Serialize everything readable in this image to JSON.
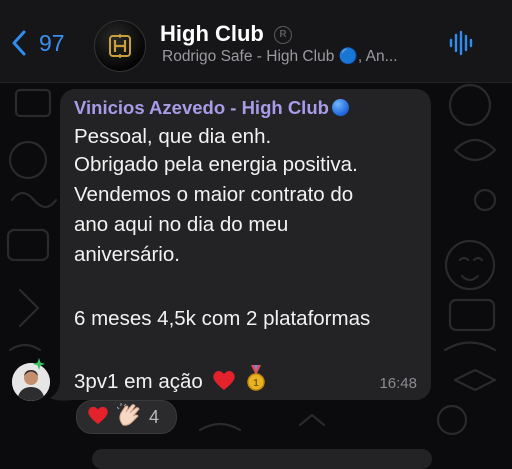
{
  "header": {
    "back_count": "97",
    "group_name": "High Club",
    "subtitle": "Rodrigo Safe - High Club 🔵, An..."
  },
  "message": {
    "sender": "Vinicios Azevedo - High Club",
    "lines": [
      "Pessoal, que dia enh.",
      "Obrigado pela energia positiva.",
      "Vendemos o maior contrato do",
      "ano aqui no dia do meu",
      "aniversário.",
      "",
      "6 meses 4,5k com 2 plataformas",
      "",
      "3pv1 em ação"
    ],
    "time": "16:48"
  },
  "reactions": {
    "count": "4",
    "items": [
      "red-heart",
      "clapping-hands"
    ]
  },
  "colors": {
    "accent": "#2f8cf0",
    "sender_name": "#a89be8",
    "bubble": "#232325",
    "background": "#0b0b0d"
  }
}
